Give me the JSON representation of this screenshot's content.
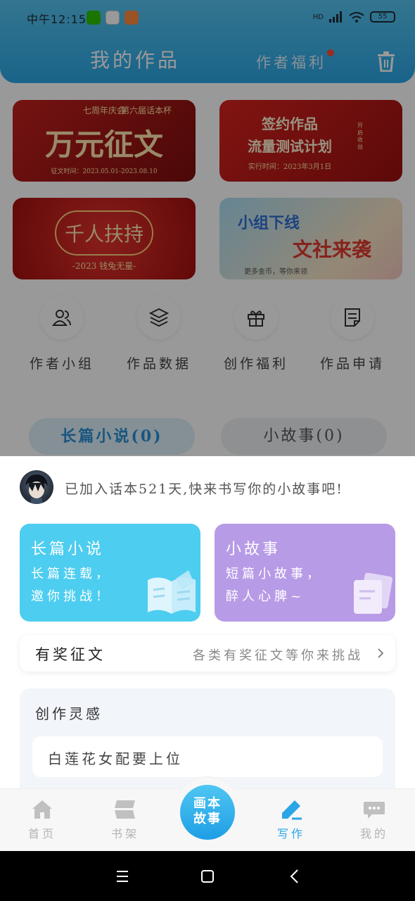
{
  "status_bar": {
    "time": "中午12:15",
    "network_label": "HD",
    "battery": "55"
  },
  "header": {
    "title": "我的作品",
    "secondary_tab": "作者福利"
  },
  "banners": [
    {
      "lines": [
        "七周年庆会",
        "第六届话本杯",
        "万元征文",
        "征文时间：2023.05.01-2023.08.10"
      ]
    },
    {
      "lines": [
        "签约作品",
        "流量测试计划",
        "实行时间：2023年3月1日",
        "开启收益"
      ]
    },
    {
      "lines": [
        "千人扶持",
        "-2023 钱兔无量-"
      ]
    },
    {
      "lines": [
        "小组下线",
        "文社来袭",
        "更多金币，等你来领"
      ]
    }
  ],
  "quick_actions": [
    {
      "label": "作者小组",
      "icon": "group-icon"
    },
    {
      "label": "作品数据",
      "icon": "layers-icon"
    },
    {
      "label": "创作福利",
      "icon": "gift-icon"
    },
    {
      "label": "作品申请",
      "icon": "document-icon"
    }
  ],
  "segments": {
    "long": "长篇小说(0)",
    "short": "小故事(0)"
  },
  "sheet": {
    "welcome": "已加入话本521天,快来书写你的小故事吧!",
    "cards": [
      {
        "title": "长篇小说",
        "desc_1": "长篇连载，",
        "desc_2": "邀你挑战！",
        "color": "#4dcdf0"
      },
      {
        "title": "小故事",
        "desc_1": "短篇小故事，",
        "desc_2": "醉人心脾~",
        "color": "#b79be6"
      }
    ],
    "contest": {
      "title": "有奖征文",
      "desc": "各类有奖征文等你来挑战"
    },
    "inspiration": {
      "title": "创作灵感",
      "items": [
        "白莲花女配要上位"
      ]
    }
  },
  "tabbar": {
    "items": [
      {
        "label": "首页",
        "icon": "home-icon"
      },
      {
        "label": "书架",
        "icon": "bookshelf-icon"
      },
      {
        "label": "写作",
        "icon": "pen-icon"
      },
      {
        "label": "我的",
        "icon": "chat-icon"
      }
    ],
    "center_button": {
      "line1": "画本",
      "line2": "故事"
    },
    "active_color": "#2aa6e6"
  }
}
